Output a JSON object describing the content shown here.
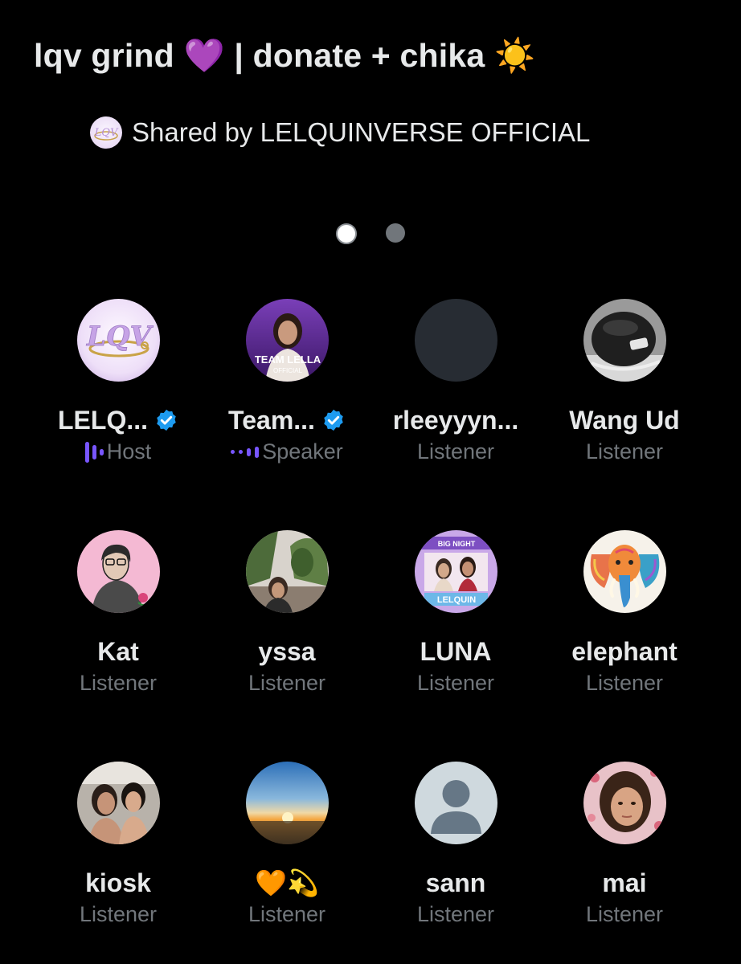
{
  "space": {
    "title": "lqv grind 💜 | donate + chika ☀️",
    "shared_by": "Shared by LELQUINVERSE OFFICIAL"
  },
  "pagination": {
    "count": 2,
    "active": 1
  },
  "participants": [
    {
      "name": "LELQ...",
      "role": "Host",
      "verified": true
    },
    {
      "name": "Team...",
      "role": "Speaker",
      "verified": true
    },
    {
      "name": "rleeyyyn...",
      "role": "Listener",
      "verified": false
    },
    {
      "name": "Wang Ud",
      "role": "Listener",
      "verified": false
    },
    {
      "name": "Kat",
      "role": "Listener",
      "verified": false
    },
    {
      "name": "yssa",
      "role": "Listener",
      "verified": false
    },
    {
      "name": "LUNA",
      "role": "Listener",
      "verified": false
    },
    {
      "name": "elephant",
      "role": "Listener",
      "verified": false
    },
    {
      "name": "kiosk",
      "role": "Listener",
      "verified": false
    },
    {
      "name": "🧡💫",
      "role": "Listener",
      "verified": false
    },
    {
      "name": "sann",
      "role": "Listener",
      "verified": false
    },
    {
      "name": "mai",
      "role": "Listener",
      "verified": false
    }
  ],
  "avatar_labels": {
    "lqv_logo": "LQV",
    "team_lella_line1": "TEAM LELLA",
    "team_lella_line2": "OFFICIAL",
    "luna_top": "BIG NIGHT",
    "luna_bottom": "LELQUIN"
  },
  "colors": {
    "background": "#000000",
    "text_primary": "#e7e9ea",
    "text_secondary": "#71767b",
    "verified_blue": "#1d9bf0",
    "speaking_purple": "#7856ff"
  }
}
